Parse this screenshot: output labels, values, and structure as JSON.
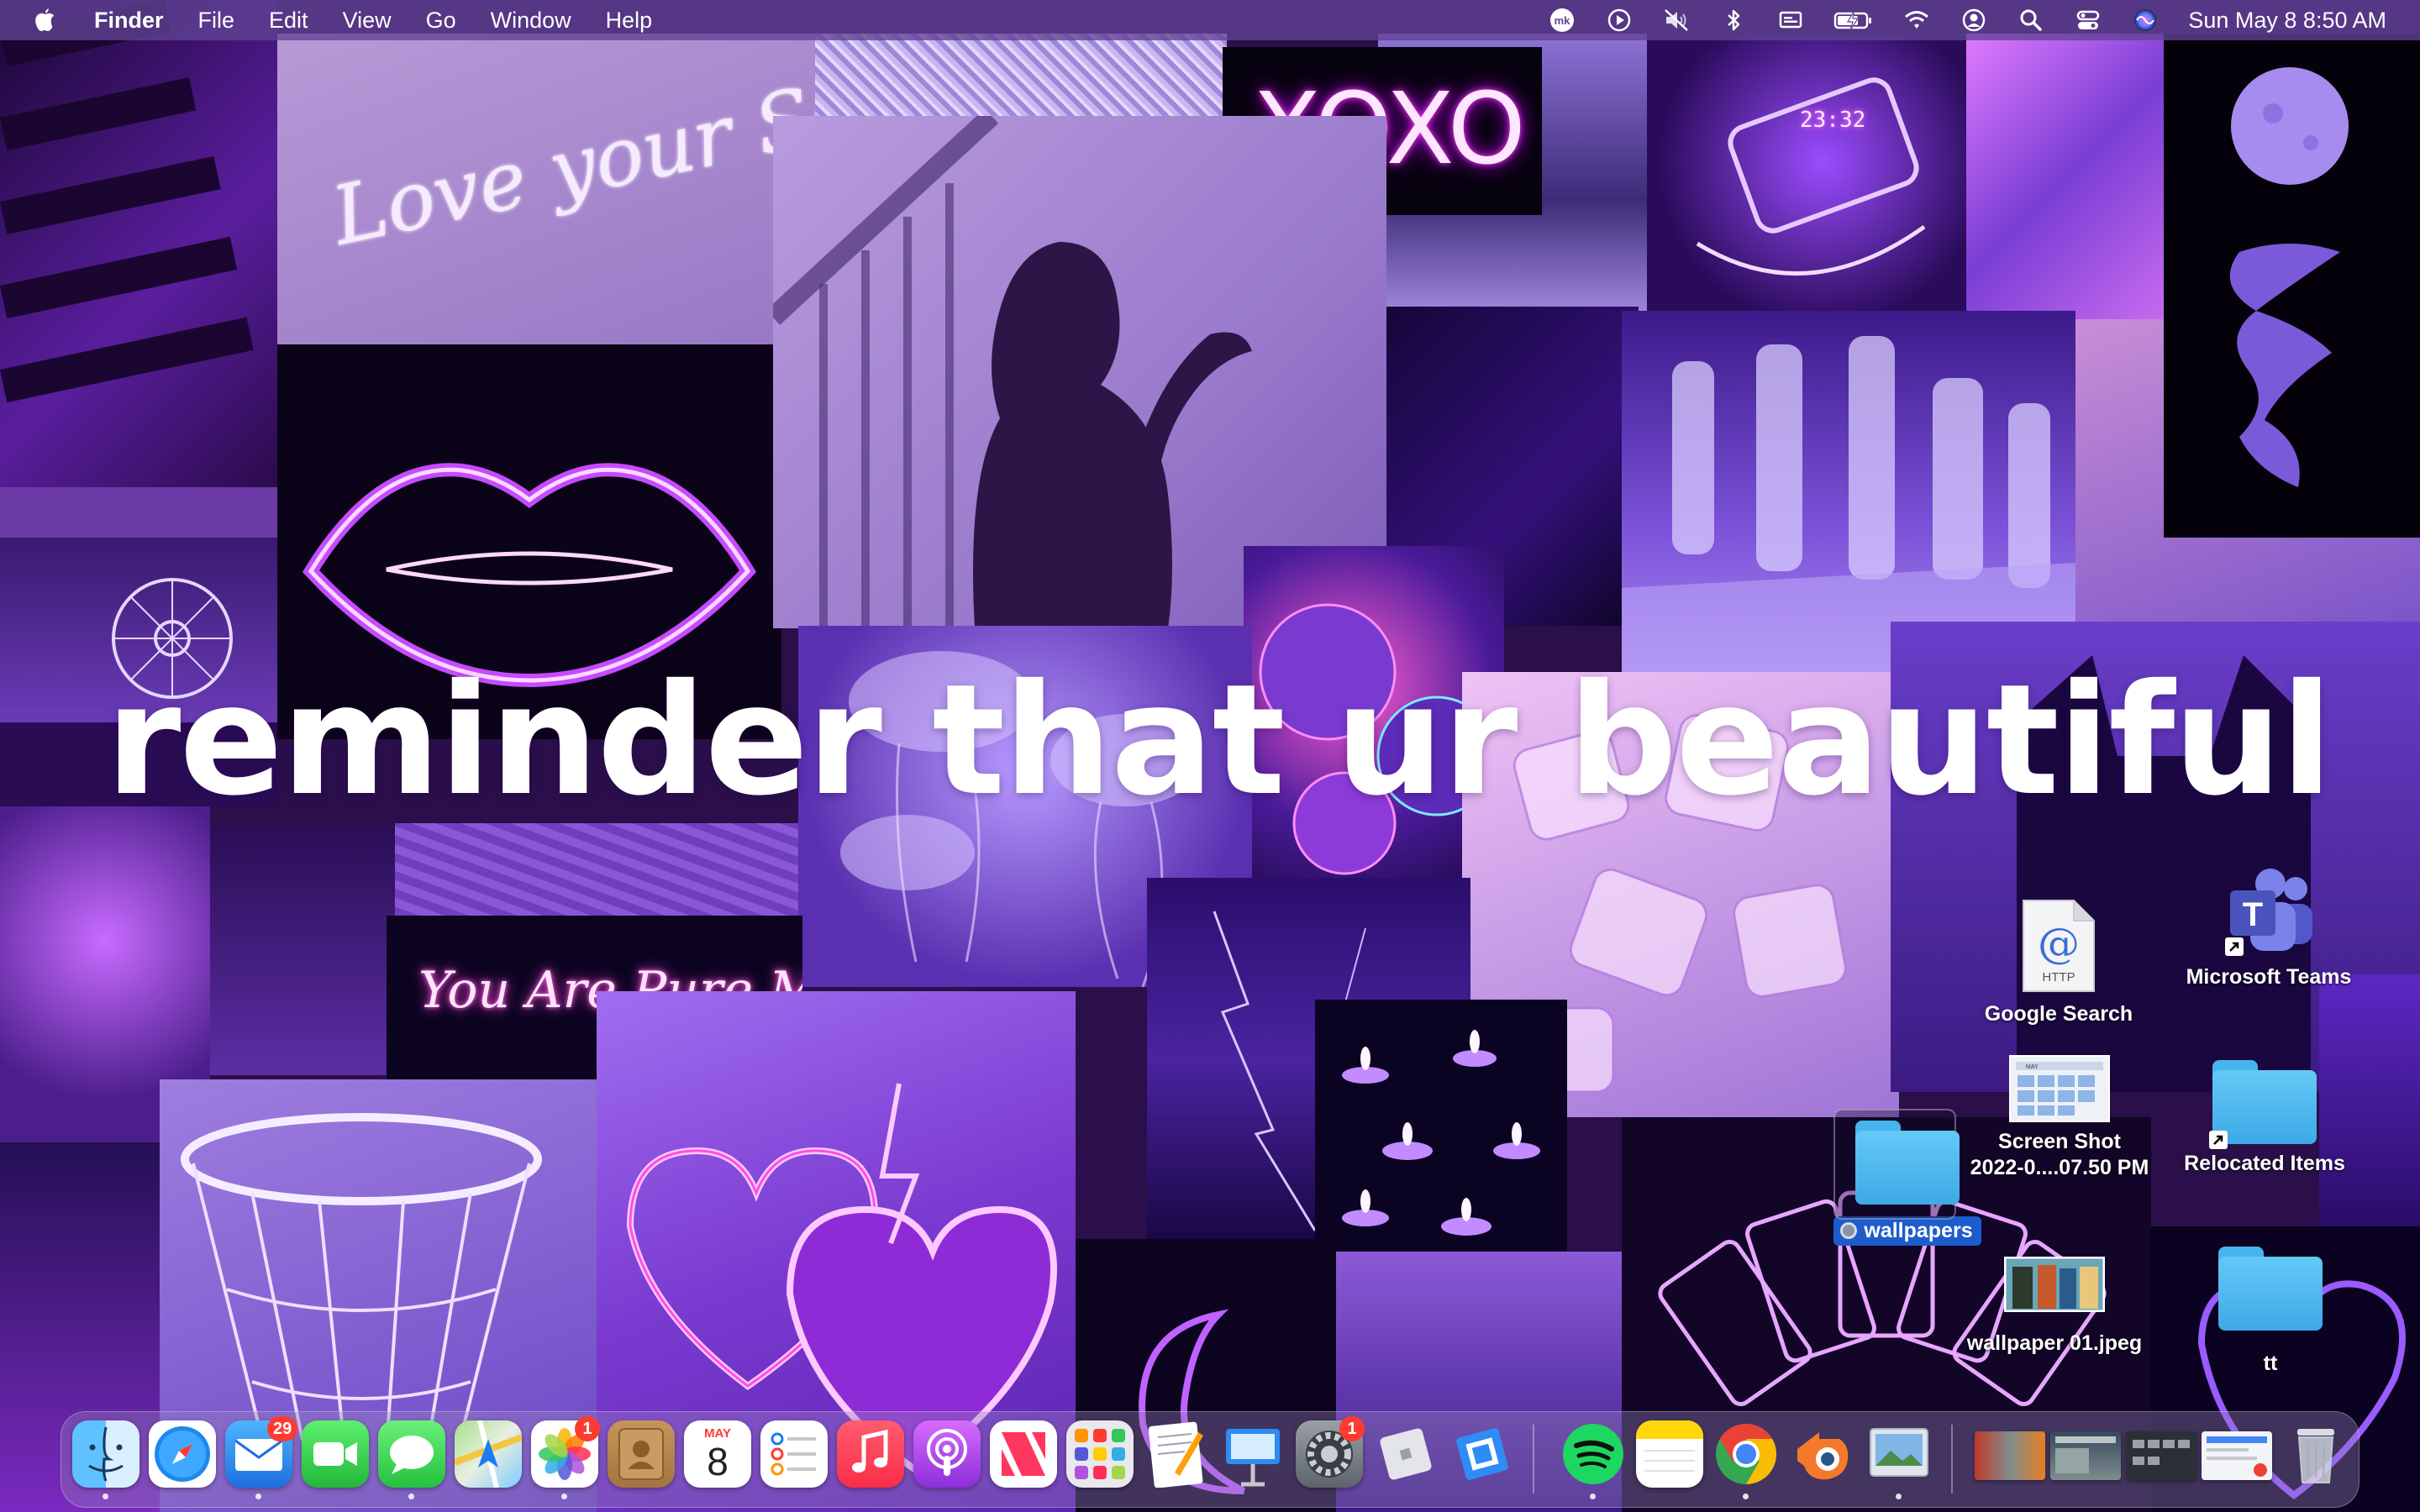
{
  "menubar": {
    "apple_icon": "apple-logo-icon",
    "app_name": "Finder",
    "menus": [
      "File",
      "Edit",
      "View",
      "Go",
      "Window",
      "Help"
    ],
    "status_icons": [
      "mk-icon",
      "play-circle-icon",
      "mute-icon",
      "bluetooth-icon",
      "display-icon",
      "battery-charging-icon",
      "wifi-icon",
      "user-icon",
      "search-icon",
      "control-center-icon",
      "siri-icon"
    ],
    "status_badge": "mk",
    "clock": "Sun May 8  8:50 AM"
  },
  "wallpaper": {
    "headline": "reminder that ur beautiful",
    "neon_love_yourself": "Love your Self",
    "neon_xoxo": "XOXO",
    "neon_pure_magic": "You Are Pure Magic",
    "phone_time": "23:32"
  },
  "desktop_icons": {
    "google_search": {
      "label": "Google Search",
      "sublabel": "HTTP",
      "icon": "http-document-icon"
    },
    "microsoft_teams": {
      "label": "Microsoft Teams",
      "icon": "teams-icon"
    },
    "screen_shot": {
      "label_line1": "Screen Shot",
      "label_line2": "2022-0....07.50 PM",
      "icon": "screenshot-thumbnail-icon",
      "thumb_month": "MAY"
    },
    "wallpapers": {
      "label": "wallpapers",
      "icon": "folder-icon",
      "tag": "gray"
    },
    "relocated_items": {
      "label": "Relocated Items",
      "icon": "folder-alias-icon"
    },
    "wallpaper_01": {
      "label": "wallpaper 01.jpeg",
      "icon": "image-thumbnail-icon"
    },
    "tt": {
      "label": "tt",
      "icon": "folder-icon"
    }
  },
  "dock": {
    "apps": [
      {
        "name": "Finder",
        "icon": "finder-icon",
        "running": true
      },
      {
        "name": "Safari",
        "icon": "safari-icon",
        "running": false
      },
      {
        "name": "Mail",
        "icon": "mail-icon",
        "running": true,
        "badge": "29"
      },
      {
        "name": "FaceTime",
        "icon": "facetime-icon",
        "running": false
      },
      {
        "name": "Messages",
        "icon": "messages-icon",
        "running": true
      },
      {
        "name": "Maps",
        "icon": "maps-icon",
        "running": false
      },
      {
        "name": "Photos",
        "icon": "photos-icon",
        "running": true,
        "badge": "1"
      },
      {
        "name": "Contacts",
        "icon": "contacts-icon",
        "running": false
      },
      {
        "name": "Calendar",
        "icon": "calendar-icon",
        "running": false,
        "month": "MAY",
        "day": "8"
      },
      {
        "name": "Reminders",
        "icon": "reminders-icon",
        "running": false
      },
      {
        "name": "Music",
        "icon": "music-icon",
        "running": false
      },
      {
        "name": "Podcasts",
        "icon": "podcasts-icon",
        "running": false
      },
      {
        "name": "News",
        "icon": "news-icon",
        "running": false
      },
      {
        "name": "Launchpad",
        "icon": "launchpad-icon",
        "running": false
      },
      {
        "name": "Pages",
        "icon": "pages-icon",
        "running": false
      },
      {
        "name": "Keynote",
        "icon": "keynote-icon",
        "running": false
      },
      {
        "name": "System Preferences",
        "icon": "system-preferences-icon",
        "running": false,
        "badge": "1"
      },
      {
        "name": "Roblox",
        "icon": "roblox-icon",
        "running": false
      },
      {
        "name": "Roblox Studio",
        "icon": "roblox-studio-icon",
        "running": false
      },
      {
        "name": "Spotify",
        "icon": "spotify-icon",
        "running": true
      },
      {
        "name": "Notes",
        "icon": "notes-icon",
        "running": false
      },
      {
        "name": "Chrome",
        "icon": "chrome-icon",
        "running": true
      },
      {
        "name": "Blender",
        "icon": "blender-icon",
        "running": false
      },
      {
        "name": "Preview",
        "icon": "preview-icon",
        "running": true
      }
    ],
    "minimized_windows": [
      "minimized-window-1",
      "minimized-window-2",
      "minimized-window-3",
      "minimized-window-4"
    ],
    "trash": {
      "name": "Trash",
      "icon": "trash-icon"
    }
  },
  "colors": {
    "menubar_bg": "#624296",
    "selection_blue": "#1d5ccc",
    "badge_red": "#ff3b30",
    "folder_blue": "#4fbaf2"
  }
}
